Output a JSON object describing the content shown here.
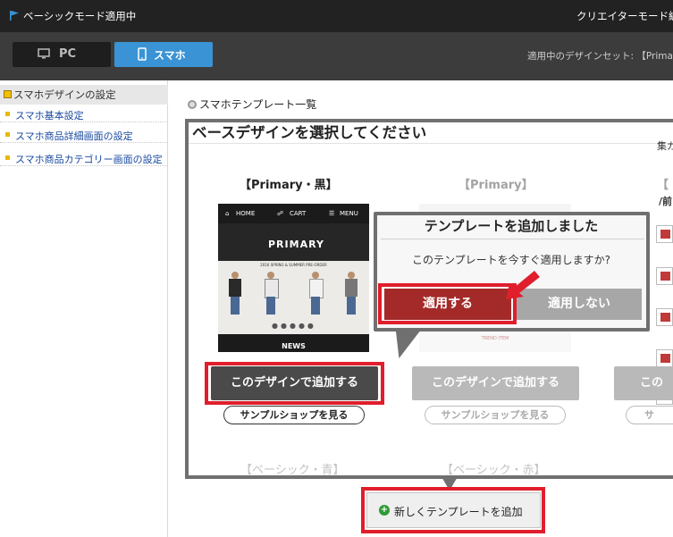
{
  "header": {
    "mode_label": "ベーシックモード適用中",
    "creator_label": "クリエイターモード編",
    "tabs": [
      {
        "label": "PC"
      },
      {
        "label": "スマホ"
      }
    ],
    "design_set_label": "適用中のデザインセット: 【Primary"
  },
  "sidebar": {
    "heading": "スマホデザインの設定",
    "items": [
      {
        "label": "スマホ基本設定"
      },
      {
        "label": "スマホ商品詳細画面の設定"
      },
      {
        "label": "スマホ商品カテゴリー画面の設定"
      }
    ]
  },
  "main": {
    "section_title": "スマホテンプレート一覧",
    "side_fragments": [
      "集ガ",
      "/前"
    ]
  },
  "modal": {
    "title": "ベースデザインを選択してください",
    "templates": [
      {
        "name": "【Primary・黒】",
        "add_label": "このデザインで追加する",
        "sample_label": "サンプルショップを見る",
        "preview": {
          "nav_items": [
            "HOME",
            "CART",
            "MENU"
          ],
          "logo": "PRIMARY",
          "caption": "2016 SPRING & SUMMER PRE-ORDER",
          "footer": "NEWS"
        }
      },
      {
        "name": "【Primary】",
        "add_label": "このデザインで追加する",
        "sample_label": "サンプルショップを見る",
        "preview": {
          "caption": "TREND ITEM"
        }
      },
      {
        "name": "【",
        "add_label": "この",
        "sample_label": "サ"
      }
    ],
    "more_templates": [
      {
        "name": "【ベーシック・青】"
      },
      {
        "name": "【ベーシック・赤】"
      }
    ]
  },
  "popup": {
    "title": "テンプレートを追加しました",
    "question": "このテンプレートを今すぐ適用しますか?",
    "apply_label": "適用する",
    "noapply_label": "適用しない"
  },
  "new_template_label": "新しくテンプレートを追加",
  "colors": {
    "accent_blue": "#3a93d4",
    "annotation_red": "#e01e2c",
    "apply_red": "#a42a2a",
    "header_dark": "#222222"
  }
}
